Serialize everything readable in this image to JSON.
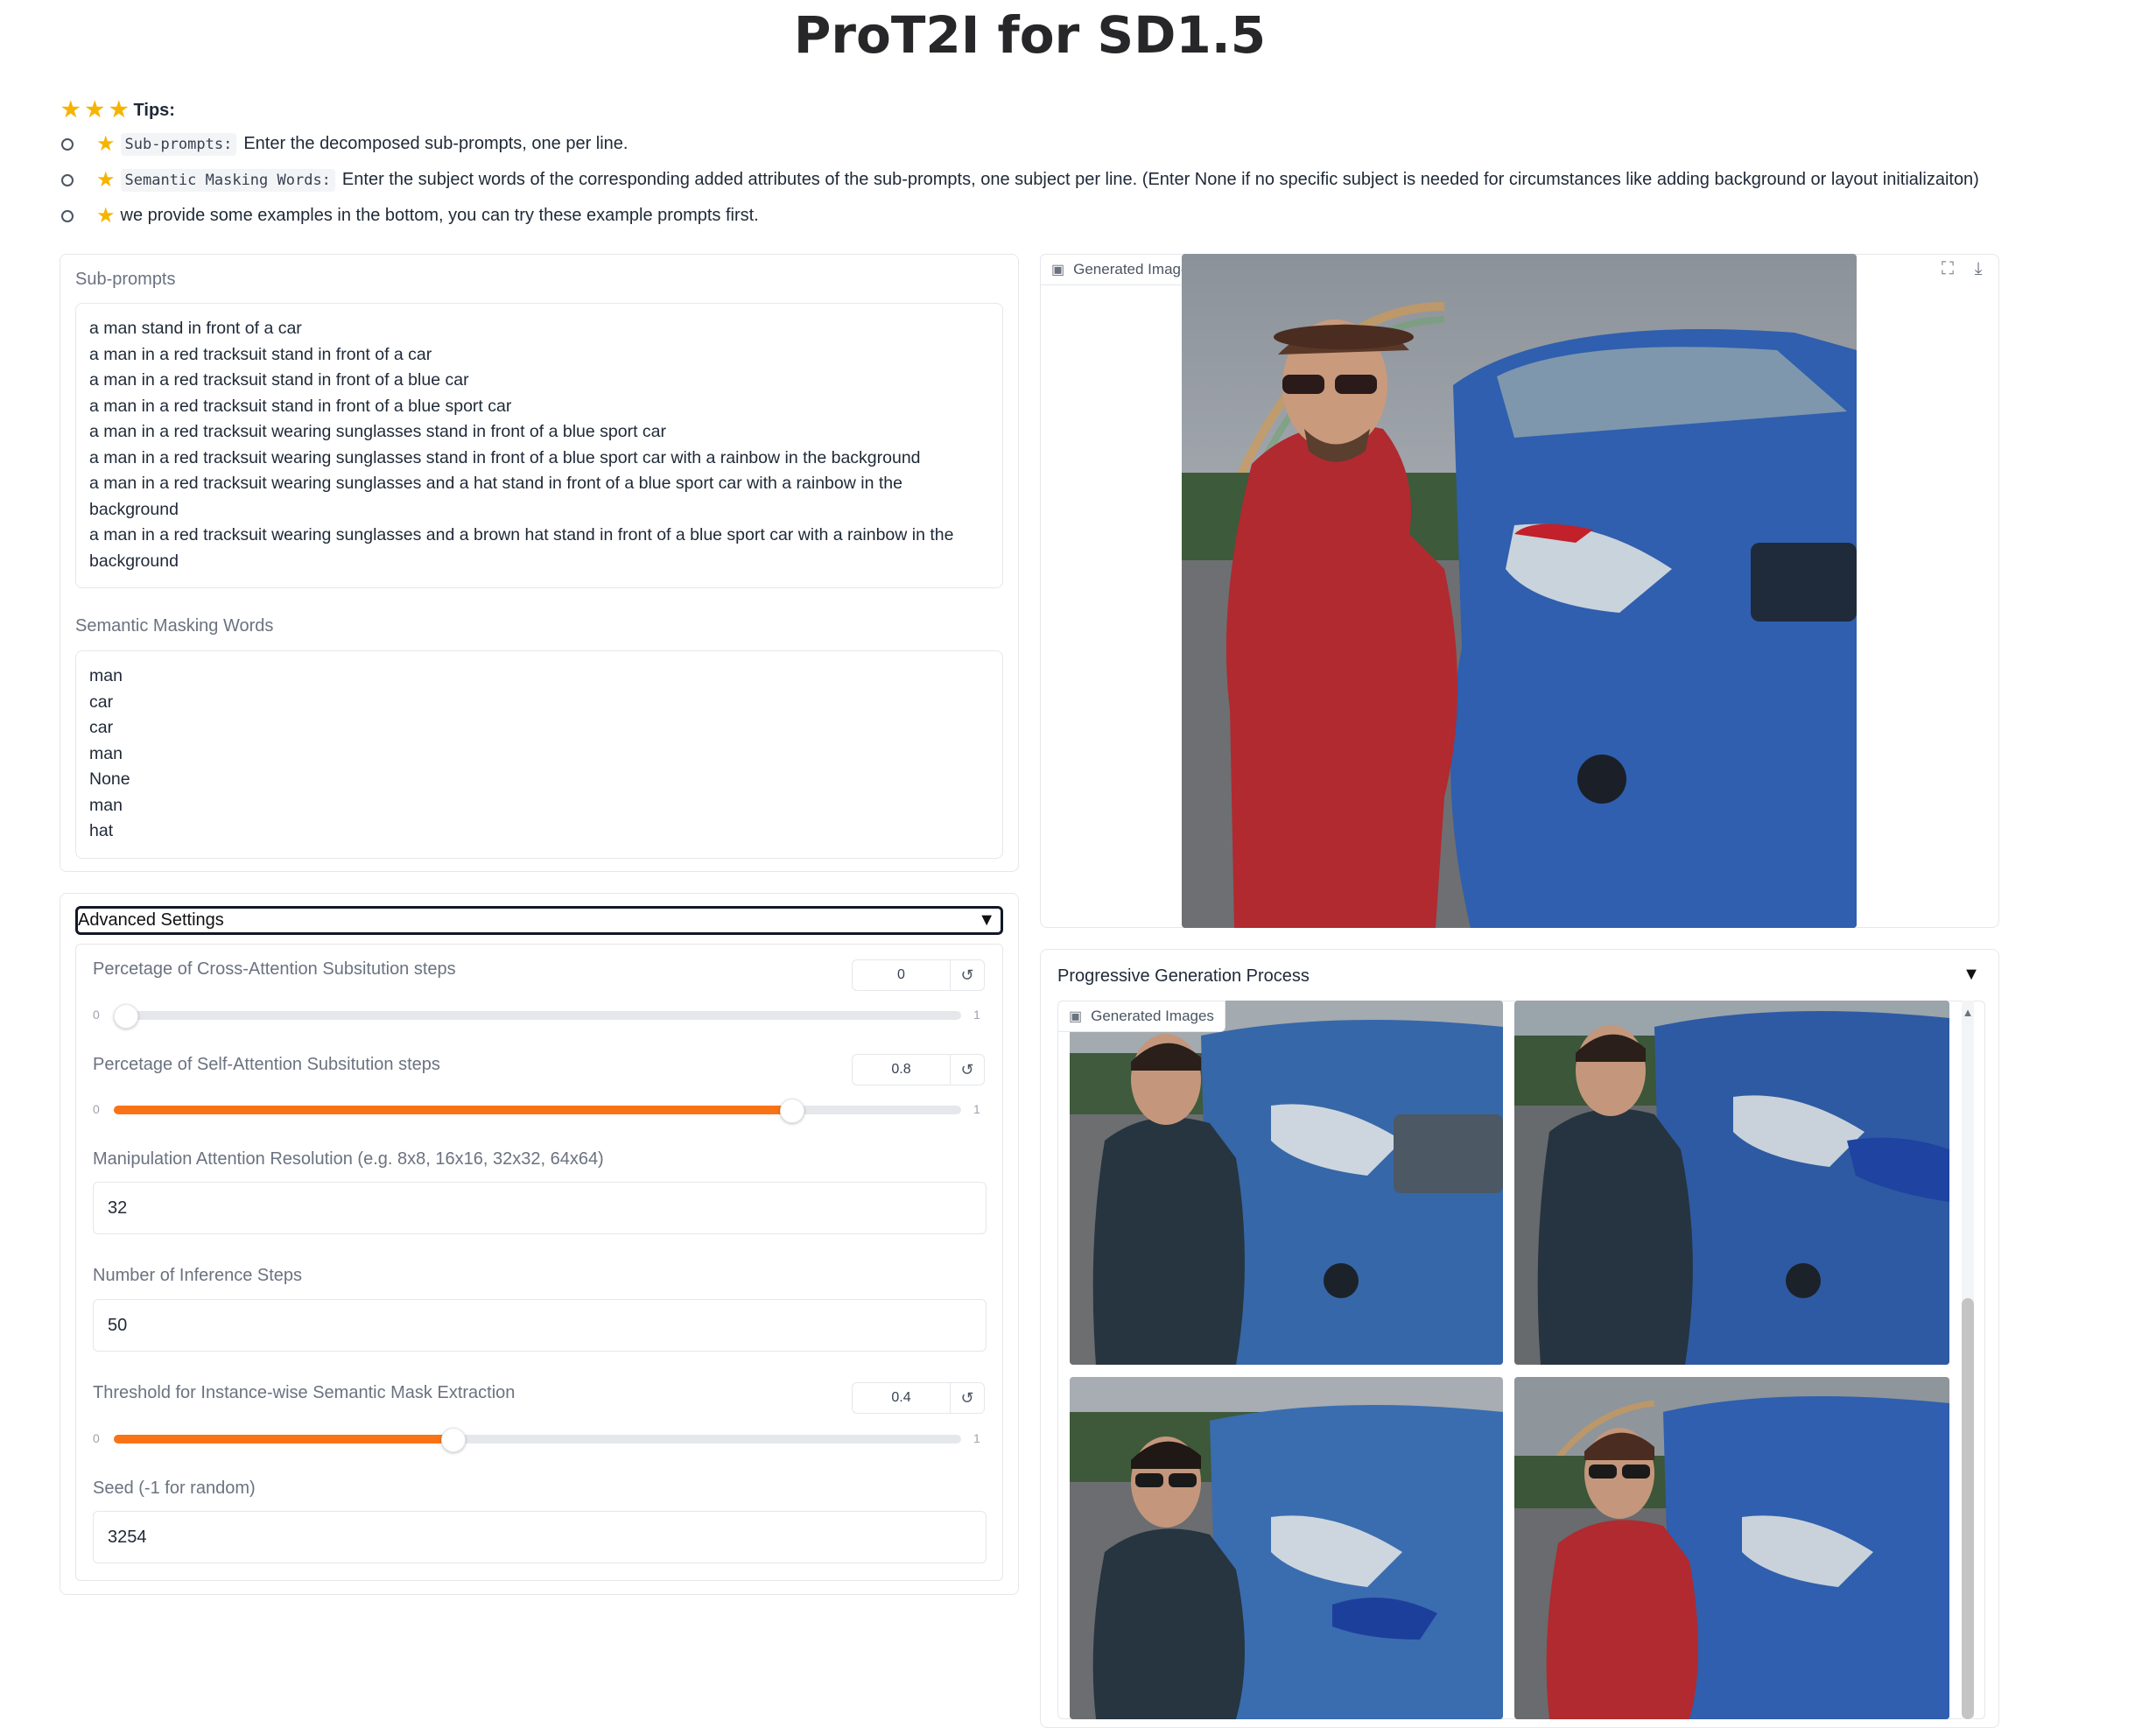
{
  "title": "ProT2I for SD1.5",
  "tips": {
    "heading": "Tips:",
    "items": [
      {
        "code": "Sub-prompts:",
        "text": "Enter the decomposed sub-prompts, one per line."
      },
      {
        "code": "Semantic Masking Words:",
        "text": "Enter the subject words of the corresponding added attributes of the sub-prompts, one subject per line. (Enter None if no specific subject is needed for circumstances like adding background or layout initializaiton)"
      },
      {
        "code": "",
        "text": "we provide some examples in the bottom, you can try these example prompts first."
      }
    ]
  },
  "subprompts": {
    "label": "Sub-prompts",
    "value": "a man stand in front of a car\na man in a red tracksuit stand in front of a car\na man in a red tracksuit stand in front of a blue car\na man in a red tracksuit stand in front of a blue sport car\na man in a red tracksuit wearing sunglasses stand in front of a blue sport car\na man in a red tracksuit wearing sunglasses stand in front of a blue sport car with a rainbow in the background\na man in a red tracksuit wearing sunglasses and a hat stand in front of a blue sport car with a rainbow in the background\na man in a red tracksuit wearing sunglasses and a brown hat stand in front of a blue sport car with a rainbow in the background"
  },
  "masking": {
    "label": "Semantic Masking Words",
    "value": "man\ncar\ncar\nman\nNone\nman\nhat"
  },
  "advanced": {
    "header": "Advanced Settings",
    "cross_attention": {
      "label": "Percetage of Cross-Attention Subsitution steps",
      "value": "0",
      "fraction": 0.0,
      "min": "0",
      "max": "1"
    },
    "self_attention": {
      "label": "Percetage of Self-Attention Subsitution steps",
      "value": "0.8",
      "fraction": 0.8,
      "min": "0",
      "max": "1"
    },
    "resolution": {
      "label": "Manipulation Attention Resolution (e.g. 8x8, 16x16, 32x32, 64x64)",
      "value": "32"
    },
    "inference_steps": {
      "label": "Number of Inference Steps",
      "value": "50"
    },
    "threshold": {
      "label": "Threshold for Instance-wise Semantic Mask Extraction",
      "value": "0.4",
      "fraction": 0.4,
      "min": "0",
      "max": "1"
    },
    "seed": {
      "label": "Seed (-1 for random)",
      "value": "3254"
    }
  },
  "output": {
    "generated_label": "Generated Image",
    "progressive_label": "Progressive Generation Process",
    "gallery_label": "Generated Images"
  },
  "colors": {
    "accent": "#f97316",
    "red_tracksuit": "#b02a30",
    "blue_car": "#2f5fae",
    "dark_jacket": "#263540"
  },
  "icons": {
    "image": "image-icon",
    "fullscreen": "fullscreen-icon",
    "download": "download-icon",
    "reset": "reset-icon"
  }
}
